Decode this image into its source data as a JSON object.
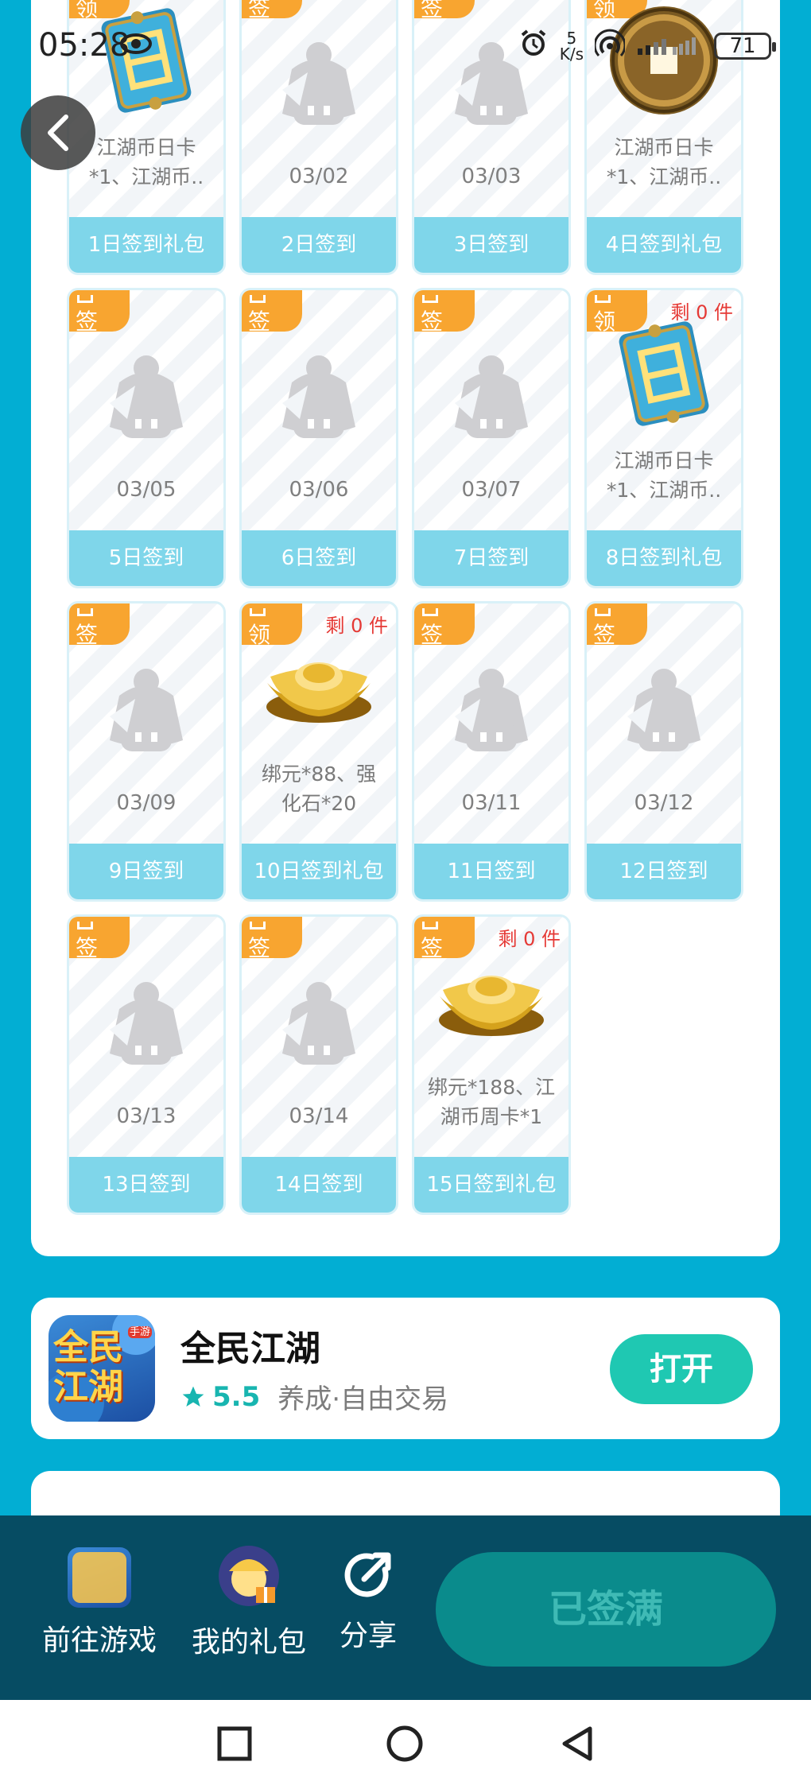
{
  "status_bar": {
    "time": "05:28",
    "net_speed_value": "5",
    "net_speed_unit": "K/s",
    "battery": "71"
  },
  "days": [
    {
      "badge": "领",
      "label": "1日签到礼包",
      "reward": "江湖币日卡*1、江湖币..",
      "reward_icon": "day-card-item-icon",
      "remain": ""
    },
    {
      "badge": "签",
      "label": "2日签到",
      "date": "03/02"
    },
    {
      "badge": "签",
      "label": "3日签到",
      "date": "03/03"
    },
    {
      "badge": "领",
      "label": "4日签到礼包",
      "reward": "江湖币日卡*1、江湖币..",
      "reward_icon": "coin-icon",
      "remain": ""
    },
    {
      "badge": "签",
      "label": "5日签到",
      "date": "03/05"
    },
    {
      "badge": "签",
      "label": "6日签到",
      "date": "03/06"
    },
    {
      "badge": "签",
      "label": "7日签到",
      "date": "03/07"
    },
    {
      "badge": "领",
      "label": "8日签到礼包",
      "reward": "江湖币日卡*1、江湖币..",
      "reward_icon": "day-card-item-icon",
      "remain": "剩 0 件"
    },
    {
      "badge": "签",
      "label": "9日签到",
      "date": "03/09"
    },
    {
      "badge": "领",
      "label": "10日签到礼包",
      "reward": "绑元*88、强化石*20",
      "reward_icon": "gold-ingot-icon",
      "remain": "剩 0 件"
    },
    {
      "badge": "签",
      "label": "11日签到",
      "date": "03/11"
    },
    {
      "badge": "签",
      "label": "12日签到",
      "date": "03/12"
    },
    {
      "badge": "签",
      "label": "13日签到",
      "date": "03/13"
    },
    {
      "badge": "签",
      "label": "14日签到",
      "date": "03/14"
    },
    {
      "badge": "签",
      "label": "15日签到礼包",
      "reward": "绑元*188、江湖币周卡*1",
      "reward_icon": "gold-ingot-icon",
      "remain": "剩 0 件"
    }
  ],
  "game": {
    "name": "全民江湖",
    "rating": "5.5",
    "tags": "养成·自由交易",
    "open_label": "打开",
    "icon_text": "全民江湖",
    "icon_badge": "手游"
  },
  "bottom_bar": {
    "goto_game": "前往游戏",
    "my_gifts": "我的礼包",
    "share": "分享",
    "signed_full": "已签满"
  },
  "colors": {
    "background": "#02aed3",
    "accent": "#1fc8b2",
    "badge": "#f8a530",
    "remain": "#e53935"
  }
}
